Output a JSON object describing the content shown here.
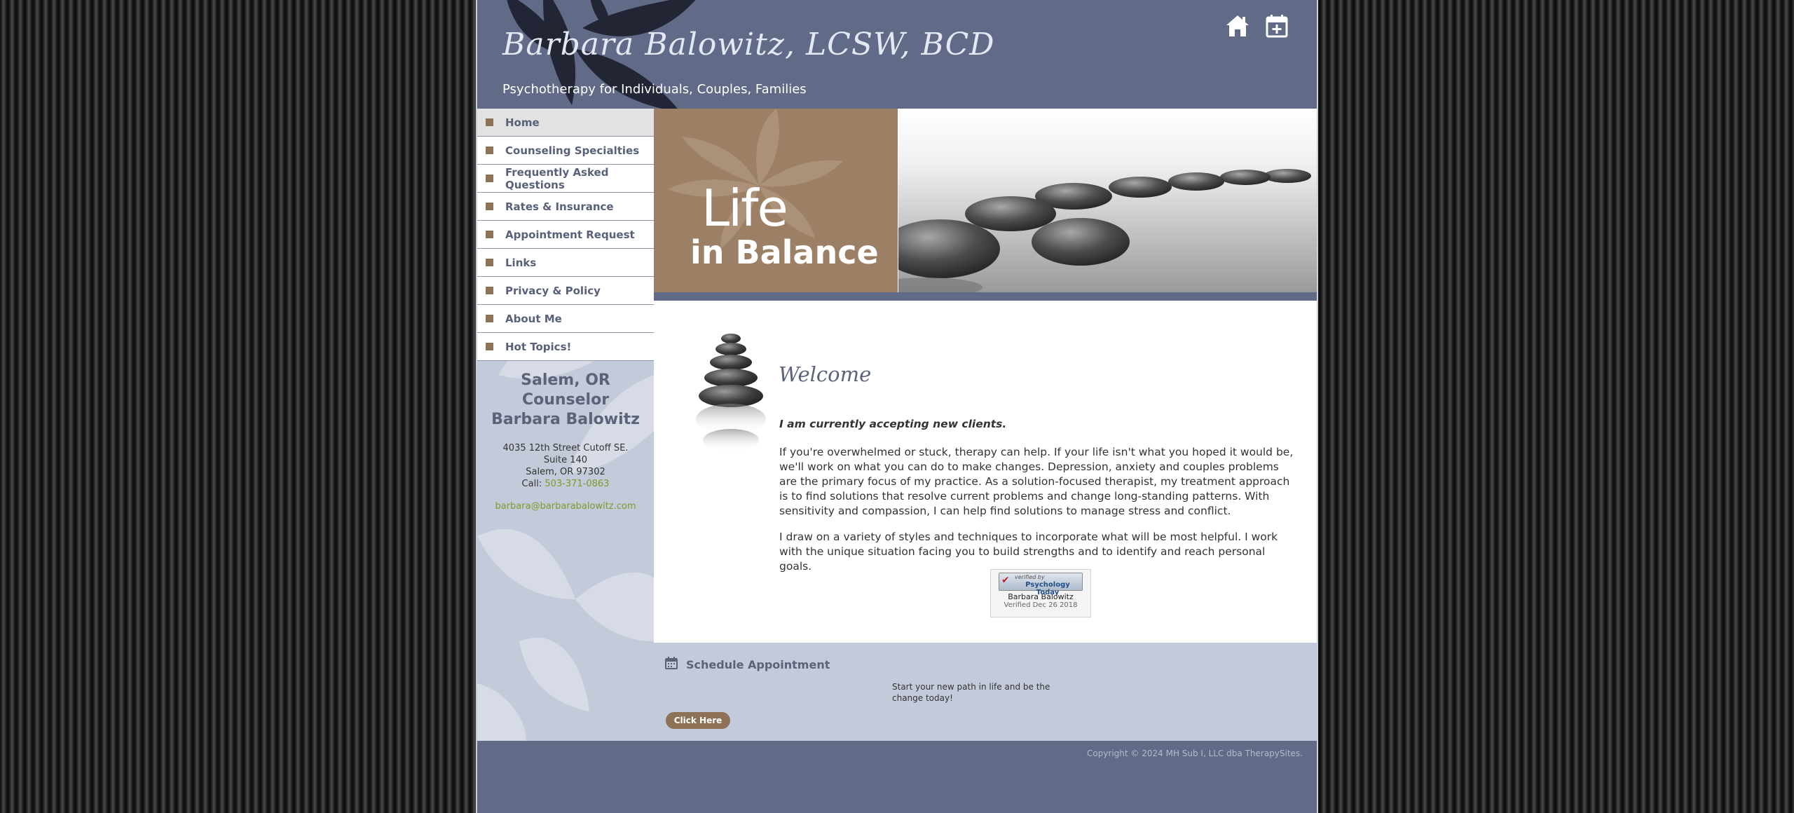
{
  "header": {
    "title": "Barbara Balowitz, LCSW, BCD",
    "subtitle": "Psychotherapy for Individuals, Couples, Families",
    "icons": [
      "home-icon",
      "calendar-add-icon"
    ]
  },
  "nav": {
    "items": [
      {
        "label": "Home"
      },
      {
        "label": "Counseling Specialties"
      },
      {
        "label": "Frequently Asked Questions"
      },
      {
        "label": "Rates & Insurance"
      },
      {
        "label": "Appointment Request"
      },
      {
        "label": "Links"
      },
      {
        "label": "Privacy & Policy"
      },
      {
        "label": "About Me"
      },
      {
        "label": "Hot Topics!"
      }
    ]
  },
  "sidebar": {
    "heading_line1": "Salem, OR Counselor",
    "heading_line2": "Barbara Balowitz",
    "address_line1": "4035 12th Street Cutoff SE.",
    "address_line2": "Suite 140",
    "address_line3": "Salem, OR 97302",
    "call_label": "Call:",
    "phone": "503-371-0863",
    "email": "barbara@barbarabalowitz.com"
  },
  "banner": {
    "line1": "Life",
    "line2": "in Balance"
  },
  "main": {
    "welcome_title": "Welcome",
    "lead": "I am currently accepting new clients.",
    "paragraph1": "If you're overwhelmed or stuck, therapy can help. If your life isn't what you hoped it would be, we'll work on what you can do to make changes. Depression, anxiety and couples problems are the primary focus of my practice.  As a solution-focused therapist, my treatment approach is to find solutions that resolve current problems and change long-standing patterns. With sensitivity and compassion, I can help find solutions to manage stress and conflict.",
    "paragraph2": " I draw on a variety of styles and techniques to incorporate what will be most helpful. I work with the unique situation facing you to build strengths and to identify and reach personal goals."
  },
  "badge": {
    "verified_by": "verified by",
    "brand": "Psychology Today",
    "name": "Barbara Balowitz",
    "date": "Verified Dec 26 2018"
  },
  "schedule": {
    "title": "Schedule Appointment",
    "text": "Start your new path in life and be the change today!",
    "button": "Click Here"
  },
  "footer": {
    "copyright": "Copyright © 2024 MH Sub I, LLC dba TherapySites."
  },
  "colors": {
    "header_bg": "#616a87",
    "nav_bullet": "#8e7257",
    "sidebar_bg": "#c3cad9",
    "link": "#7f9a2c",
    "button_bg": "#8e7257"
  }
}
